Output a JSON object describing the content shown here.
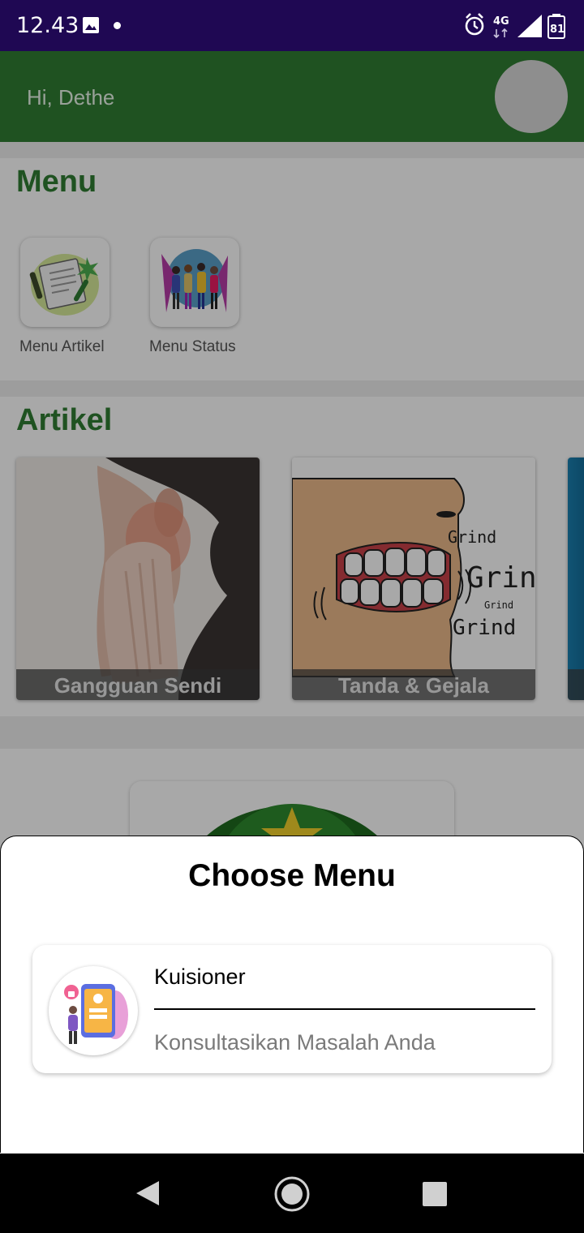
{
  "status_bar": {
    "time": "12.43",
    "network": "4G",
    "battery": "81",
    "icons": [
      "gallery-icon",
      "notification-dot-icon",
      "alarm-icon",
      "network-4g-icon",
      "signal-icon",
      "battery-icon"
    ]
  },
  "header": {
    "greeting": "Hi, Dethe"
  },
  "menu_section": {
    "title": "Menu",
    "items": [
      {
        "label": "Menu Artikel",
        "icon": "article-illustration-icon"
      },
      {
        "label": "Menu Status",
        "icon": "people-status-illustration-icon"
      }
    ]
  },
  "articles_section": {
    "title": "Artikel",
    "items": [
      {
        "caption": "Gangguan Sendi"
      },
      {
        "caption": "Tanda & Gejala",
        "image_text": [
          "Grind",
          "Grind",
          "Grind",
          "Grind"
        ]
      }
    ]
  },
  "bottom_sheet": {
    "title": "Choose Menu",
    "item": {
      "title": "Kuisioner",
      "subtitle": "Konsultasikan Masalah Anda",
      "icon": "questionnaire-phone-icon"
    }
  },
  "nav_bar": {
    "buttons": [
      "back-icon",
      "home-icon",
      "recents-icon"
    ]
  },
  "colors": {
    "status_bar": "#1f0853",
    "app_bar": "#2f7d32",
    "section_title": "#2f7d32",
    "scrim": "rgba(0,0,0,0.34)"
  }
}
